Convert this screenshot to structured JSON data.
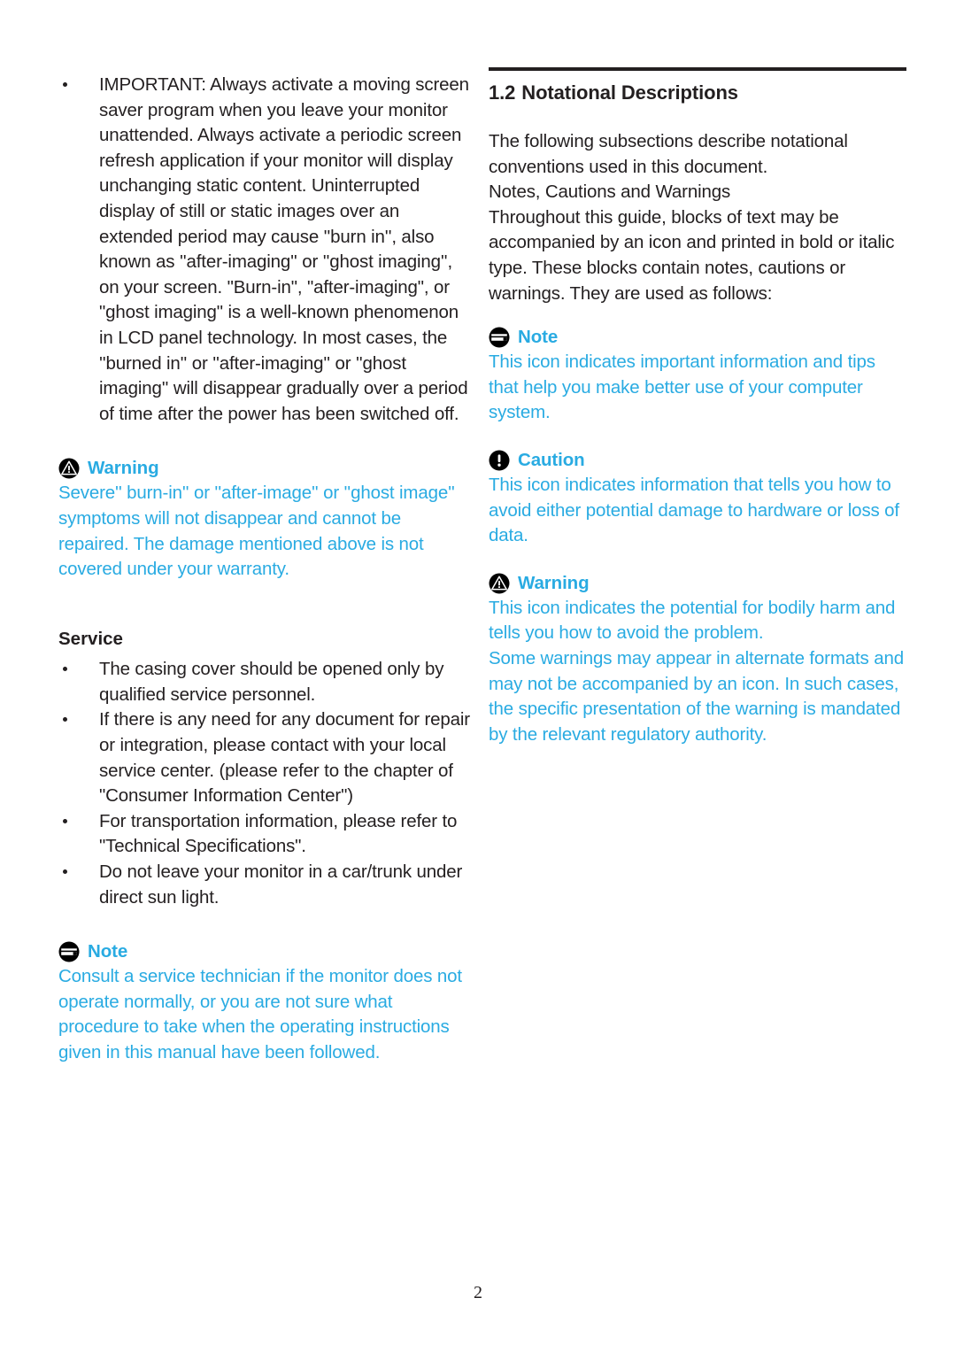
{
  "page": {
    "number": "2",
    "accent_blue": "#29abe2",
    "text_color": "#231f20"
  },
  "left_column": {
    "important_bullet": "IMPORTANT: Always activate a moving screen saver program when you leave your monitor unattended. Always activate a periodic screen refresh application if your monitor will display unchanging static content. Uninterrupted display of still or static images over an extended period may cause ''burn in'', also known as ''after-imaging'' or ''ghost imaging'', on your screen. \"Burn-in\", \"after-imaging\", or \"ghost imaging\" is a well-known phenomenon in LCD panel technology. In most cases, the ''burned in'' or ''after-imaging'' or ''ghost imaging'' will disappear gradually over a period of time after the power has been switched off.",
    "warning": {
      "icon": "warning-triangle-circle-icon",
      "title": "Warning",
      "body": "Severe'' burn-in'' or ''after-image'' or ''ghost image'' symptoms will not disappear and cannot be repaired. The damage mentioned above is not covered under your warranty."
    },
    "service": {
      "heading": "Service",
      "bullets": [
        "The casing cover should be opened only by qualified service personnel.",
        "If there is any need for any document for repair or integration, please contact with your local service center. (please refer to the chapter of \"Consumer Information Center\")",
        "For transportation information, please refer to \"Technical Specifications\".",
        "Do not leave your monitor in a car/trunk under direct sun light."
      ]
    },
    "note": {
      "icon": "note-lines-circle-icon",
      "title": "Note",
      "body": "Consult a service technician if the monitor does not operate normally, or you are not sure what procedure to take when the operating instructions given in this manual have been followed."
    }
  },
  "right_column": {
    "chapter": {
      "number": "1.2",
      "title": "Notational Descriptions"
    },
    "intro": "The following subsections describe notational conventions used in this document.",
    "subheading": "Notes, Cautions and Warnings",
    "intro2": "Throughout this guide, blocks of text may be accompanied by an icon and printed in bold or italic type. These blocks contain notes, cautions or warnings. They are used as follows:",
    "note": {
      "icon": "note-lines-circle-icon",
      "title": "Note",
      "body": "This icon indicates important information and tips that help you make better use of your computer system."
    },
    "caution": {
      "icon": "caution-exclamation-circle-icon",
      "title": "Caution",
      "body": "This icon indicates information that tells you how to avoid either potential damage to hardware or loss of data."
    },
    "warning": {
      "icon": "warning-triangle-circle-icon",
      "title": "Warning",
      "body": "This icon indicates the potential for bodily harm and tells you how to avoid the problem.",
      "body2": "Some warnings may appear in alternate formats and may not be accompanied by an icon. In such cases, the specific presentation of the warning is mandated by the relevant regulatory authority."
    }
  }
}
